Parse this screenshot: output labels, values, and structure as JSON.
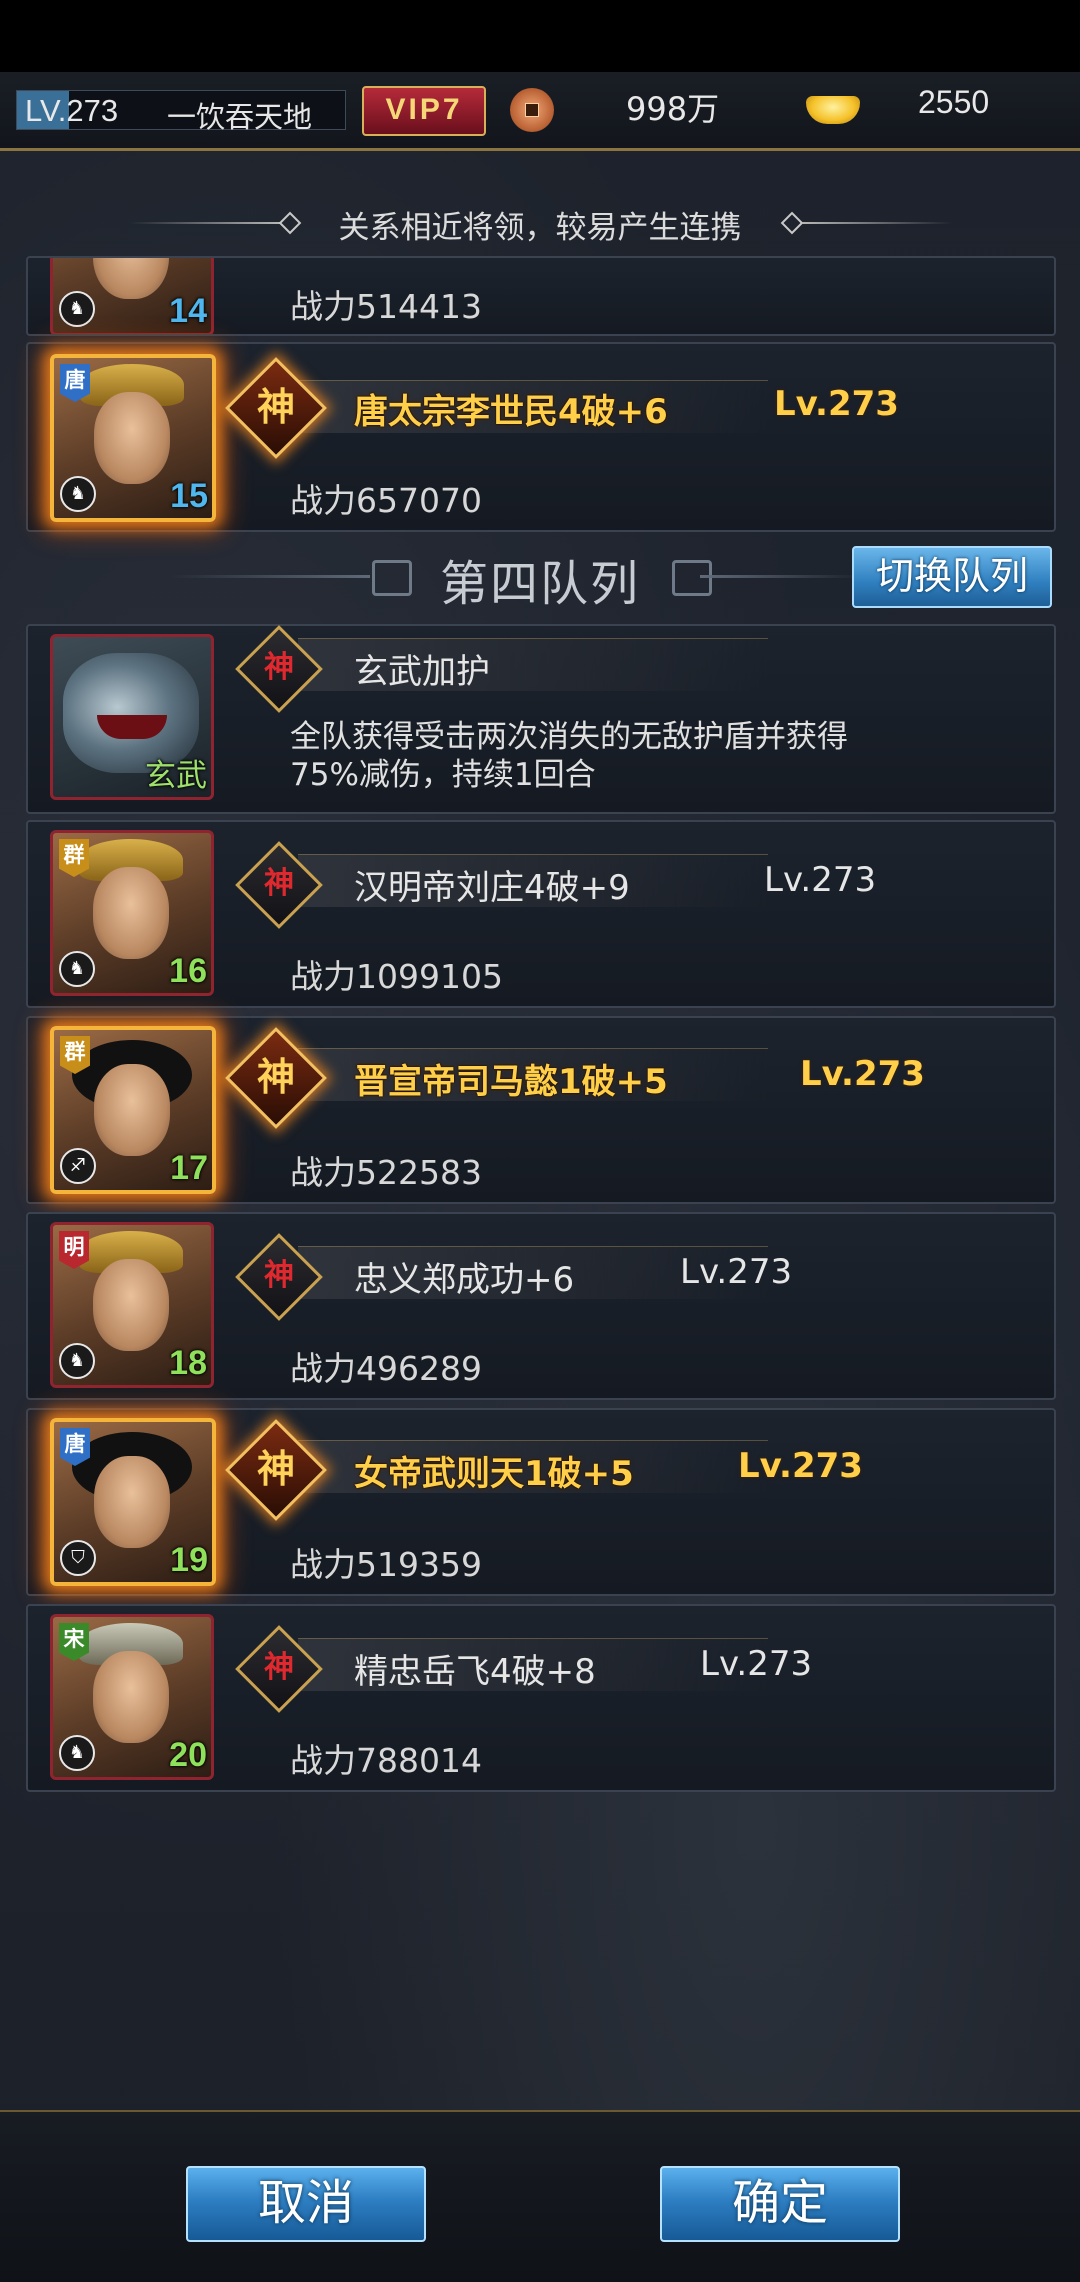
{
  "header": {
    "level": "LV.273",
    "player_name": "一饮吞天地",
    "vip": "VIP7",
    "coins": "998万",
    "ingots": "2550"
  },
  "hint": "关系相近将领，较易产生连携",
  "queue": {
    "title": "第四队列",
    "switch_label": "切换队列"
  },
  "generals_top": [
    {
      "position": "14",
      "power": "战力514413"
    },
    {
      "position": "15",
      "faction": "唐",
      "name": "唐太宗李世民4破+6",
      "level": "Lv.273",
      "power": "战力657070",
      "shen": "神"
    }
  ],
  "beast": {
    "name": "玄武加护",
    "label": "玄武",
    "shen": "神",
    "description_line1": "全队获得受击两次消失的无敌护盾并获得",
    "description_line2": "75%减伤，持续1回合"
  },
  "generals": [
    {
      "position": "16",
      "faction": "群",
      "name": "汉明帝刘庄4破+9",
      "level": "Lv.273",
      "power": "战力1099105",
      "shen": "神"
    },
    {
      "position": "17",
      "faction": "群",
      "name": "晋宣帝司马懿1破+5",
      "level": "Lv.273",
      "power": "战力522583",
      "shen": "神"
    },
    {
      "position": "18",
      "faction": "明",
      "name": "忠义郑成功+6",
      "level": "Lv.273",
      "power": "战力496289",
      "shen": "神"
    },
    {
      "position": "19",
      "faction": "唐",
      "name": "女帝武则天1破+5",
      "level": "Lv.273",
      "power": "战力519359",
      "shen": "神"
    },
    {
      "position": "20",
      "faction": "宋",
      "name": "精忠岳飞4破+8",
      "level": "Lv.273",
      "power": "战力788014",
      "shen": "神"
    }
  ],
  "footer": {
    "cancel_label": "取消",
    "confirm_label": "确定"
  },
  "colors": {
    "gold_text": "#ffcf4a",
    "button_blue": "#2d7ec2",
    "number_blue": "#4fb7ee",
    "number_green": "#8fe05a"
  },
  "icons": [
    "coin-icon",
    "ingot-icon",
    "shen-badge-icon",
    "role-icon"
  ]
}
